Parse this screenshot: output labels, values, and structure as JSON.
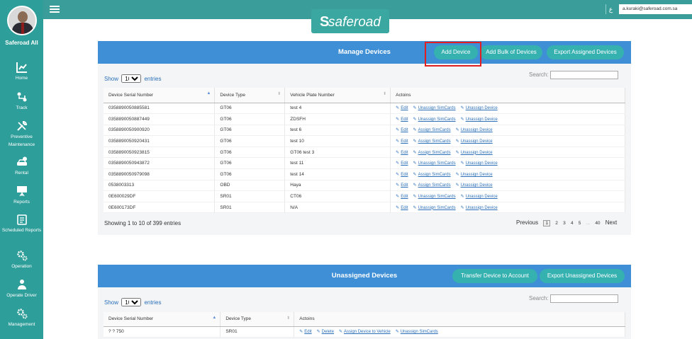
{
  "topbar": {
    "lang": "ع",
    "user_email": "a.kuraki@saferoad.com.sa"
  },
  "logo": {
    "text": "saferoad"
  },
  "sidebar": {
    "account_name": "Saferoad All",
    "items": [
      {
        "label": "Home",
        "icon": "chart-icon"
      },
      {
        "label": "Track",
        "icon": "route-icon"
      },
      {
        "label": "Preventive Maintenance",
        "icon": "wrench-icon"
      },
      {
        "label": "Rental",
        "icon": "car-money-icon"
      },
      {
        "label": "Reports",
        "icon": "presentation-icon"
      },
      {
        "label": "Scheduled Reports",
        "icon": "calendar-report-icon"
      },
      {
        "label": "Operation",
        "icon": "gears-icon"
      },
      {
        "label": "Operate Driver",
        "icon": "driver-icon"
      },
      {
        "label": "Management",
        "icon": "gears-icon"
      }
    ]
  },
  "manage": {
    "title": "Manage Devices",
    "buttons": {
      "add_device": "Add Device",
      "add_bulk": "Add Bulk of Devices",
      "export_assigned": "Export Assigned Devices"
    },
    "show_label": "Show",
    "page_size": "10",
    "entries_label": "entries",
    "search_label": "Search:",
    "columns": [
      "Device Serial Number",
      "Device Type",
      "Vehicle Plate Number",
      "Actoins"
    ],
    "rows": [
      {
        "serial": "0358890050885581",
        "type": "GT06",
        "plate": "test 4",
        "actions": [
          "Edit",
          "Unassign SimCards",
          "Unassign Device"
        ]
      },
      {
        "serial": "0358890050887449",
        "type": "GT06",
        "plate": "ZDSFH",
        "actions": [
          "Edit",
          "Unassign SimCards",
          "Unassign Device"
        ]
      },
      {
        "serial": "0358890050900920",
        "type": "GT06",
        "plate": "test 6",
        "actions": [
          "Edit",
          "Assign SimCards",
          "Unassign Device"
        ]
      },
      {
        "serial": "0358890050920431",
        "type": "GT06",
        "plate": "test 10",
        "actions": [
          "Edit",
          "Assign SimCards",
          "Unassign Device"
        ]
      },
      {
        "serial": "0358890050923815",
        "type": "GT06",
        "plate": "GT06 test 3",
        "actions": [
          "Edit",
          "Assign SimCards",
          "Unassign Device"
        ]
      },
      {
        "serial": "0358890050943872",
        "type": "GT06",
        "plate": "test 11",
        "actions": [
          "Edit",
          "Unassign SimCards",
          "Unassign Device"
        ]
      },
      {
        "serial": "0358890050979098",
        "type": "GT06",
        "plate": "test 14",
        "actions": [
          "Edit",
          "Assign SimCards",
          "Unassign Device"
        ]
      },
      {
        "serial": "0538003313",
        "type": "OBD",
        "plate": "Haya",
        "actions": [
          "Edit",
          "Assign SimCards",
          "Unassign Device"
        ]
      },
      {
        "serial": "0E600029DF",
        "type": "SR01",
        "plate": "CT06",
        "actions": [
          "Edit",
          "Unassign SimCards",
          "Unassign Device"
        ]
      },
      {
        "serial": "0E600173DF",
        "type": "SR01",
        "plate": "N/A",
        "actions": [
          "Edit",
          "Unassign SimCards",
          "Unassign Device"
        ]
      }
    ],
    "info": "Showing 1 to 10 of 399 entries",
    "pagination": {
      "previous": "Previous",
      "pages": [
        "1",
        "2",
        "3",
        "4",
        "5",
        "...",
        "40"
      ],
      "next": "Next"
    }
  },
  "unassigned": {
    "title": "Unassigned Devices",
    "buttons": {
      "transfer": "Transfer Device to Account",
      "export_unassigned": "Export Unassigned Devices"
    },
    "show_label": "Show",
    "page_size": "10",
    "entries_label": "entries",
    "search_label": "Search:",
    "columns": [
      "Device Serial Number",
      "Device Type",
      "Actoins"
    ],
    "rows": [
      {
        "serial": "? ? 750",
        "type": "SR01",
        "actions": [
          "Edit",
          "Delete",
          "Assign Device to Vehicle",
          "Unassign SimCards"
        ]
      }
    ]
  }
}
